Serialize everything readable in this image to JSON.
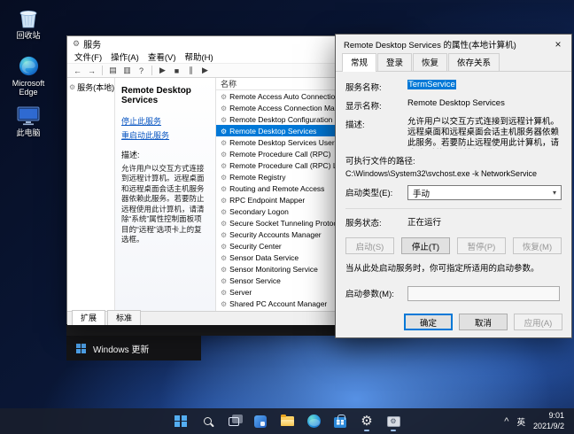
{
  "desktop": {
    "icons": [
      {
        "label": "回收站"
      },
      {
        "label": "Microsoft Edge"
      },
      {
        "label": "此电脑"
      }
    ]
  },
  "icons": {
    "back": "←",
    "forward": "→",
    "window": "▤",
    "export": "▥",
    "help": "?",
    "play": "▶",
    "stop": "■",
    "pause": "∥",
    "restart": "▶",
    "combo_arrow": "▾",
    "close": "×",
    "chevron_up": "^"
  },
  "servicesWindow": {
    "title": "服务",
    "menu": [
      "文件(F)",
      "操作(A)",
      "查看(V)",
      "帮助(H)"
    ],
    "tree": {
      "root": "服务(本地)"
    },
    "extendedPane": {
      "serviceTitle": "Remote Desktop Services",
      "stopLink": "停止此服务",
      "restartLink": "重启动此服务",
      "descriptionLabel": "描述:",
      "description": "允许用户以交互方式连接到远程计算机。远程桌面和远程桌面会话主机服务器依赖此服务。若要防止远程使用此计算机，请清除“系统”属性控制面板项目的“远程”选项卡上的复选框。"
    },
    "list": {
      "nameColumn": "名称",
      "items": [
        "Remote Access Auto Connection ...",
        "Remote Access Connection Man...",
        "Remote Desktop Configuration",
        "Remote Desktop Services",
        "Remote Desktop Services UserM...",
        "Remote Procedure Call (RPC)",
        "Remote Procedure Call (RPC) L...",
        "Remote Registry",
        "Routing and Remote Access",
        "RPC Endpoint Mapper",
        "Secondary Logon",
        "Secure Socket Tunneling Protoco...",
        "Security Accounts Manager",
        "Security Center",
        "Sensor Data Service",
        "Sensor Monitoring Service",
        "Sensor Service",
        "Server",
        "Shared PC Account Manager"
      ]
    },
    "tabs": [
      "扩展",
      "标准"
    ]
  },
  "propertiesDialog": {
    "title": "Remote Desktop Services 的属性(本地计算机)",
    "tabs": [
      "常规",
      "登录",
      "恢复",
      "依存关系"
    ],
    "fields": {
      "serviceNameLabel": "服务名称:",
      "serviceName": "TermService",
      "displayNameLabel": "显示名称:",
      "displayName": "Remote Desktop Services",
      "descriptionLabel": "描述:",
      "description": "允许用户以交互方式连接到远程计算机。远程桌面和远程桌面会话主机服务器依赖此服务。若要防止远程使用此计算机，请清除“系统”属性控制面板...",
      "pathLabel": "可执行文件的路径:",
      "path": "C:\\Windows\\System32\\svchost.exe -k NetworkService",
      "startupTypeLabel": "启动类型(E):",
      "startupType": "手动",
      "serviceStatusLabel": "服务状态:",
      "serviceStatus": "正在运行"
    },
    "controlButtons": {
      "start": "启动(S)",
      "stop": "停止(T)",
      "pause": "暂停(P)",
      "resume": "恢复(M)"
    },
    "startParamsNote": "当从此处启动服务时，你可指定所适用的启动参数。",
    "startParamsLabel": "启动参数(M):",
    "footer": {
      "ok": "确定",
      "cancel": "取消",
      "apply": "应用(A)"
    }
  },
  "backgroundWindow": {
    "title": "Windows 更新"
  },
  "taskbar": {
    "tray": {
      "lang": "英",
      "time": "9:01",
      "date": "2021/9/2"
    }
  }
}
